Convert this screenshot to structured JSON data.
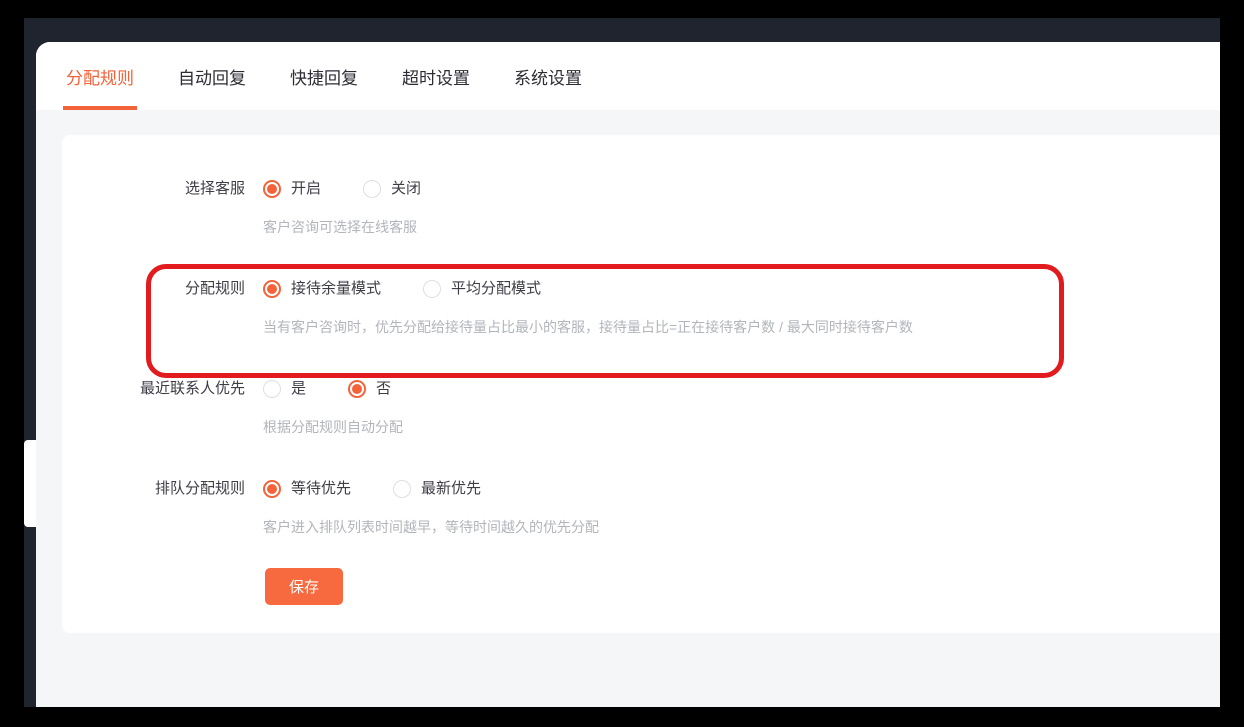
{
  "tabs": {
    "items": [
      {
        "label": "分配规则",
        "active": true
      },
      {
        "label": "自动回复",
        "active": false
      },
      {
        "label": "快捷回复",
        "active": false
      },
      {
        "label": "超时设置",
        "active": false
      },
      {
        "label": "系统设置",
        "active": false
      }
    ]
  },
  "form": {
    "rows": [
      {
        "label": "选择客服",
        "options": [
          {
            "label": "开启",
            "selected": true
          },
          {
            "label": "关闭",
            "selected": false
          }
        ],
        "hint": "客户咨询可选择在线客服"
      },
      {
        "label": "分配规则",
        "options": [
          {
            "label": "接待余量模式",
            "selected": true
          },
          {
            "label": "平均分配模式",
            "selected": false
          }
        ],
        "hint": "当有客户咨询时，优先分配给接待量占比最小的客服，接待量占比=正在接待客户数 / 最大同时接待客户数",
        "highlighted": true
      },
      {
        "label": "最近联系人优先",
        "options": [
          {
            "label": "是",
            "selected": false
          },
          {
            "label": "否",
            "selected": true
          }
        ],
        "hint": "根据分配规则自动分配"
      },
      {
        "label": "排队分配规则",
        "options": [
          {
            "label": "等待优先",
            "selected": true
          },
          {
            "label": "最新优先",
            "selected": false
          }
        ],
        "hint": "客户进入排队列表时间越早，等待时间越久的优先分配"
      }
    ],
    "save_label": "保存"
  },
  "annotation": {
    "shape": "rounded-rectangle",
    "color": "#e11b1e",
    "highlights_row": "分配规则"
  },
  "colors": {
    "accent_orange": "#f4623a",
    "save_button": "#f76a3f",
    "annotation_red": "#e11b1e",
    "window_bg": "#20242f",
    "content_bg": "#f5f6f7",
    "hint_text": "#b2b5bb"
  }
}
